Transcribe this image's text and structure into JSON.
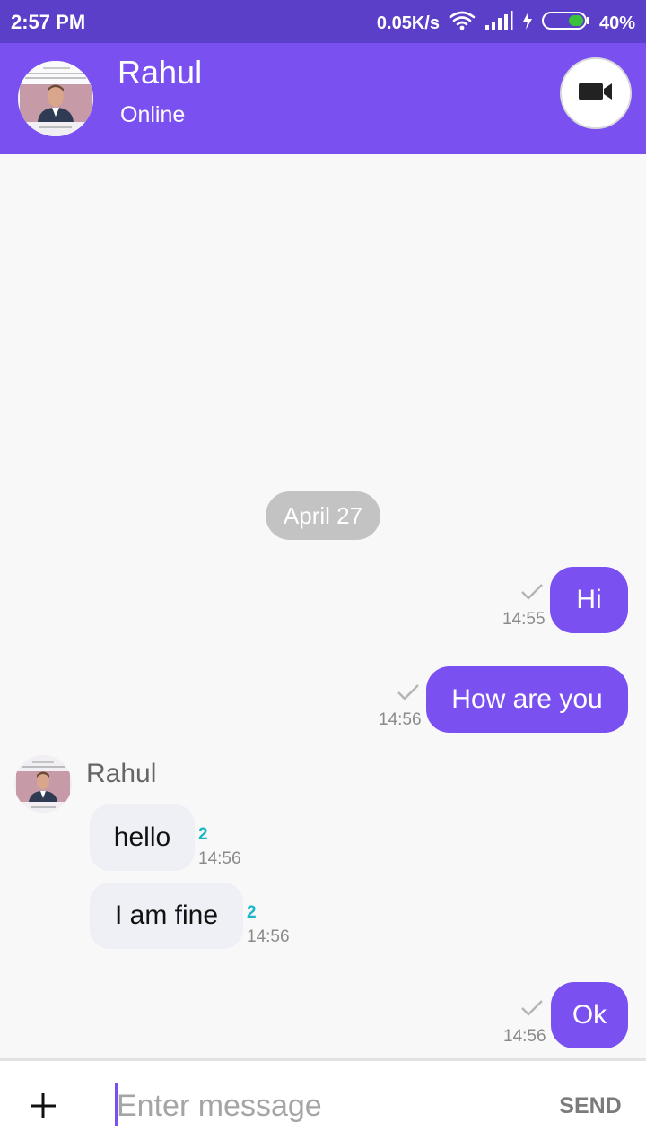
{
  "status_bar": {
    "time": "2:57 PM",
    "network_speed": "0.05K/s",
    "battery": "40%",
    "icons": [
      "wifi-icon",
      "signal-icon",
      "charging-icon",
      "battery-icon"
    ]
  },
  "header": {
    "name": "Rahul",
    "status": "Online",
    "video_icon": "video-camera-icon"
  },
  "chat": {
    "date_label": "April 27",
    "messages": [
      {
        "direction": "out",
        "text": "Hi",
        "time": "14:55",
        "status": "sent"
      },
      {
        "direction": "out",
        "text": "How are you",
        "time": "14:56",
        "status": "sent"
      },
      {
        "direction": "in",
        "sender": "Rahul",
        "text": "hello",
        "time": "14:56",
        "count": "2"
      },
      {
        "direction": "in",
        "sender": "Rahul",
        "text": "I am fine",
        "time": "14:56",
        "count": "2"
      },
      {
        "direction": "out",
        "text": "Ok",
        "time": "14:56",
        "status": "sent"
      }
    ]
  },
  "input": {
    "placeholder": "Enter message",
    "value": "",
    "send_label": "SEND"
  },
  "colors": {
    "status_bar": "#5b3fc8",
    "header": "#7a50f0",
    "outgoing_bubble": "#7a50f0",
    "incoming_bubble": "#eef0f5",
    "read_count": "#19b5c9",
    "date_pill": "#c3c3c3"
  }
}
